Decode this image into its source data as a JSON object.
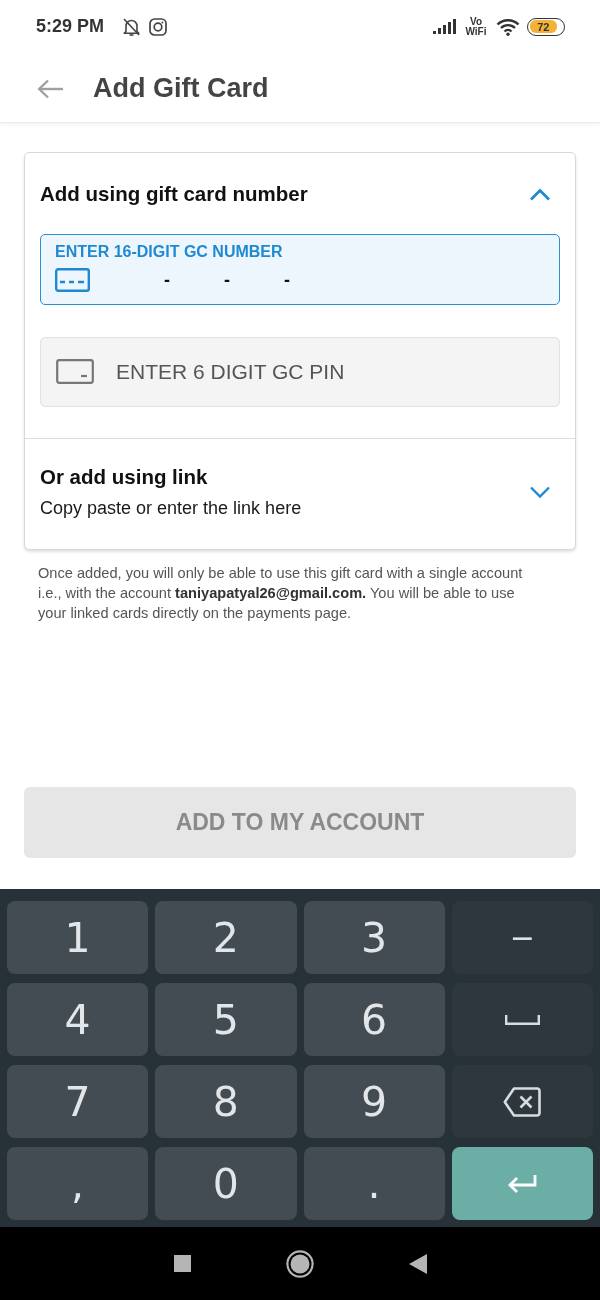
{
  "status_bar": {
    "time": "5:29 PM",
    "network_label": "Vo WiFi",
    "battery": "72"
  },
  "app_bar": {
    "title": "Add Gift Card"
  },
  "sections": [
    {
      "kind": "number_form",
      "title": "Add using gift card number",
      "expanded": true,
      "fields": [
        {
          "kind": "card_number",
          "label": "ENTER 16-DIGIT GC NUMBER",
          "separators": [
            "-",
            "-",
            "-"
          ],
          "focused": true
        },
        {
          "kind": "pin",
          "placeholder": "ENTER 6 DIGIT GC PIN",
          "focused": false
        }
      ]
    },
    {
      "kind": "link",
      "title": "Or add using link",
      "subtitle": "Copy paste or enter the link here",
      "expanded": false
    }
  ],
  "note": "Once added, you will only be able to use this gift card with a single account i.e., with the account **taniyapatyal26@gmail.com.** You will be able to use your linked cards directly on the payments page.",
  "submit_button": {
    "label": "ADD TO MY ACCOUNT",
    "disabled": true
  },
  "keyboard": {
    "rows": [
      [
        {
          "kind": "char",
          "label": "1"
        },
        {
          "kind": "char",
          "label": "2"
        },
        {
          "kind": "char",
          "label": "3"
        },
        {
          "kind": "function",
          "label": "−"
        }
      ],
      [
        {
          "kind": "char",
          "label": "4"
        },
        {
          "kind": "char",
          "label": "5"
        },
        {
          "kind": "char",
          "label": "6"
        },
        {
          "kind": "space"
        }
      ],
      [
        {
          "kind": "char",
          "label": "7"
        },
        {
          "kind": "char",
          "label": "8"
        },
        {
          "kind": "char",
          "label": "9"
        },
        {
          "kind": "backspace"
        }
      ],
      [
        {
          "kind": "char",
          "label": ","
        },
        {
          "kind": "char",
          "label": "0"
        },
        {
          "kind": "char",
          "label": "."
        },
        {
          "kind": "enter"
        }
      ]
    ]
  }
}
